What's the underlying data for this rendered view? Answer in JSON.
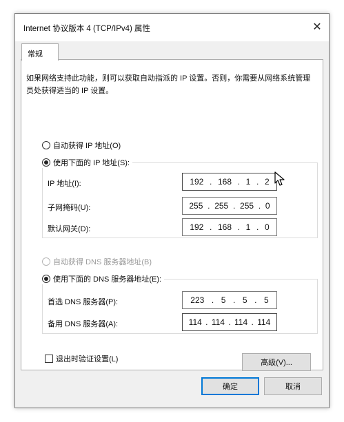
{
  "dialog": {
    "title": "Internet 协议版本 4 (TCP/IPv4) 属性",
    "close_glyph": "✕"
  },
  "tabs": [
    {
      "label": "常规"
    }
  ],
  "description": "如果网络支持此功能，则可以获取自动指派的 IP 设置。否则，你需要从网络系统管理员处获得适当的 IP 设置。",
  "ip_section": {
    "auto_label": "自动获得 IP 地址(O)",
    "auto_checked": false,
    "manual_label": "使用下面的 IP 地址(S):",
    "manual_checked": true,
    "fields": [
      {
        "label": "IP 地址(I):",
        "octets": [
          "192",
          "168",
          "1",
          "2"
        ]
      },
      {
        "label": "子网掩码(U):",
        "octets": [
          "255",
          "255",
          "255",
          "0"
        ]
      },
      {
        "label": "默认网关(D):",
        "octets": [
          "192",
          "168",
          "1",
          "0"
        ]
      }
    ]
  },
  "dns_section": {
    "auto_label": "自动获得 DNS 服务器地址(B)",
    "auto_checked": false,
    "auto_disabled": true,
    "manual_label": "使用下面的 DNS 服务器地址(E):",
    "manual_checked": true,
    "fields": [
      {
        "label": "首选 DNS 服务器(P):",
        "octets": [
          "223",
          "5",
          "5",
          "5"
        ]
      },
      {
        "label": "备用 DNS 服务器(A):",
        "octets": [
          "114",
          "114",
          "114",
          "114"
        ]
      }
    ]
  },
  "validate_label": "退出时验证设置(L)",
  "validate_checked": false,
  "advanced_button": "高级(V)...",
  "ok_button": "确定",
  "cancel_button": "取消",
  "cursor_icon": "mouse-pointer-icon"
}
